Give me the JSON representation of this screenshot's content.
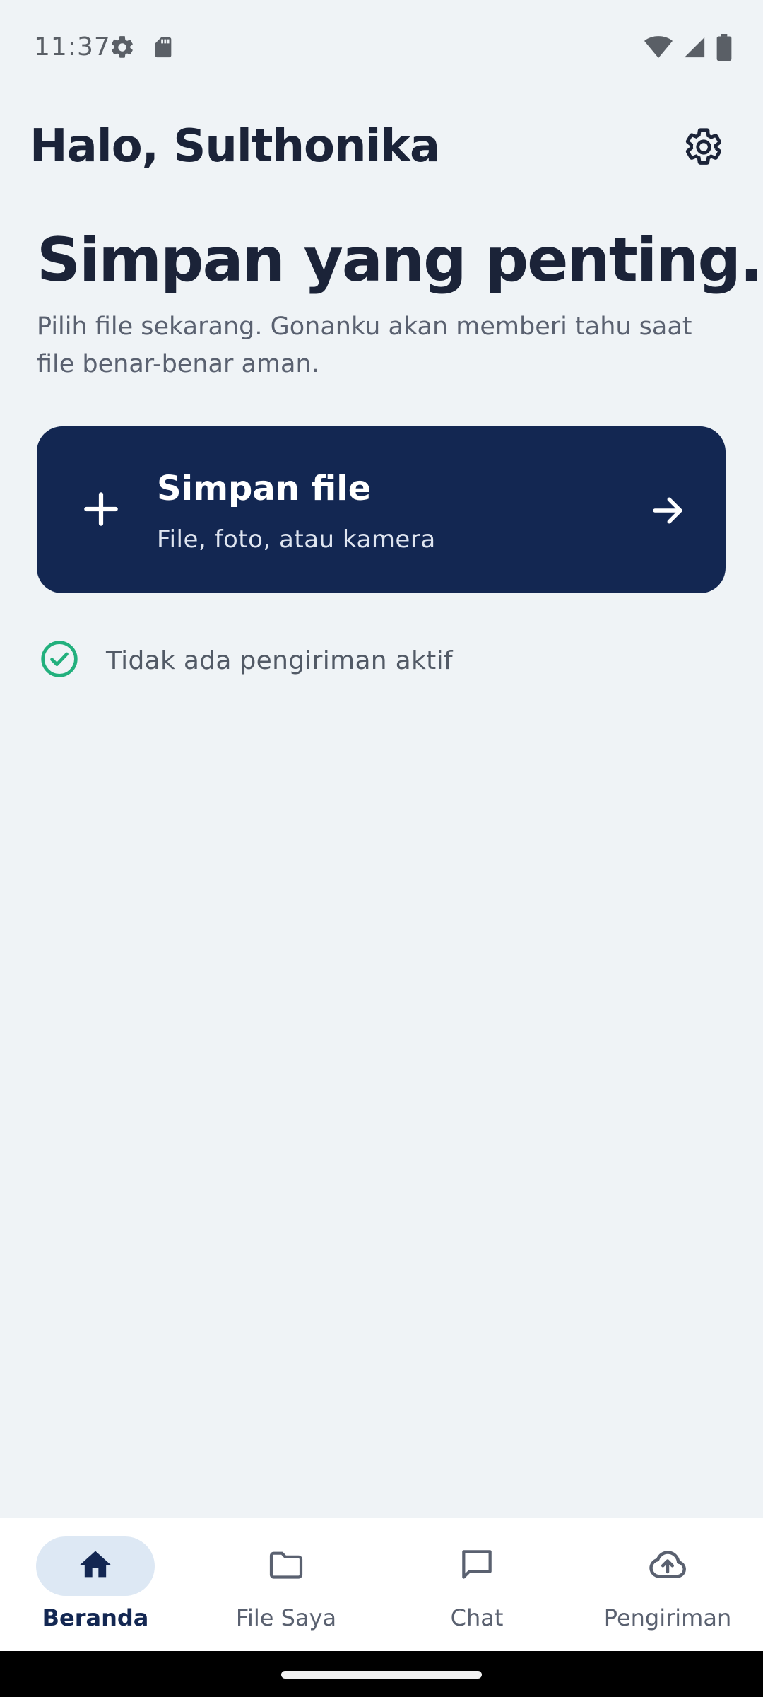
{
  "status_bar": {
    "time": "11:37",
    "left_icons": [
      "settings-gear-icon",
      "sd-card-icon"
    ],
    "right_icons": [
      "wifi-icon",
      "cellular-signal-icon",
      "battery-icon"
    ]
  },
  "header": {
    "greeting": "Halo, Sulthonika",
    "settings_icon": "gear-icon"
  },
  "hero": {
    "title": "Simpan yang penting.",
    "subtitle": "Pilih file sekarang. Gonanku akan memberi tahu saat file benar-benar aman."
  },
  "save_card": {
    "title": "Simpan file",
    "subtitle": "File, foto, atau kamera",
    "icon": "plus-icon",
    "trailing_icon": "arrow-right-icon",
    "background_color": "#132752"
  },
  "transfer_status": {
    "text": "Tidak ada pengiriman aktif",
    "icon": "check-circle-icon",
    "color": "#22b07d"
  },
  "bottom_nav": {
    "items": [
      {
        "label": "Beranda",
        "icon": "home-icon",
        "active": true
      },
      {
        "label": "File Saya",
        "icon": "folder-icon",
        "active": false
      },
      {
        "label": "Chat",
        "icon": "chat-icon",
        "active": false
      },
      {
        "label": "Pengiriman",
        "icon": "cloud-upload-icon",
        "active": false
      }
    ]
  },
  "colors": {
    "background": "#eff3f6",
    "primary": "#132752",
    "text": "#1b2338",
    "muted_text": "#5a6170",
    "active_pill": "#dde8f4"
  }
}
